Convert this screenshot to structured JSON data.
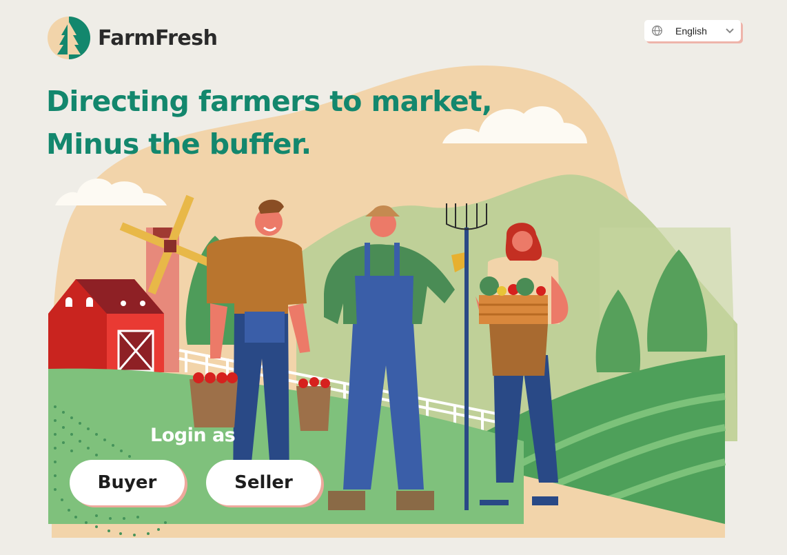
{
  "brand": {
    "name": "FarmFresh",
    "logo_icon": "pine-tree-icon",
    "colors": {
      "primary": "#13876d",
      "accent": "#eea89c"
    }
  },
  "language_selector": {
    "value": "English",
    "icon": "globe-icon",
    "chevron_icon": "chevron-down-icon"
  },
  "hero": {
    "headline_line1": "Directing farmers to market,",
    "headline_line2": "Minus the buffer."
  },
  "login": {
    "label": "Login as",
    "buyer_label": "Buyer",
    "seller_label": "Seller"
  }
}
